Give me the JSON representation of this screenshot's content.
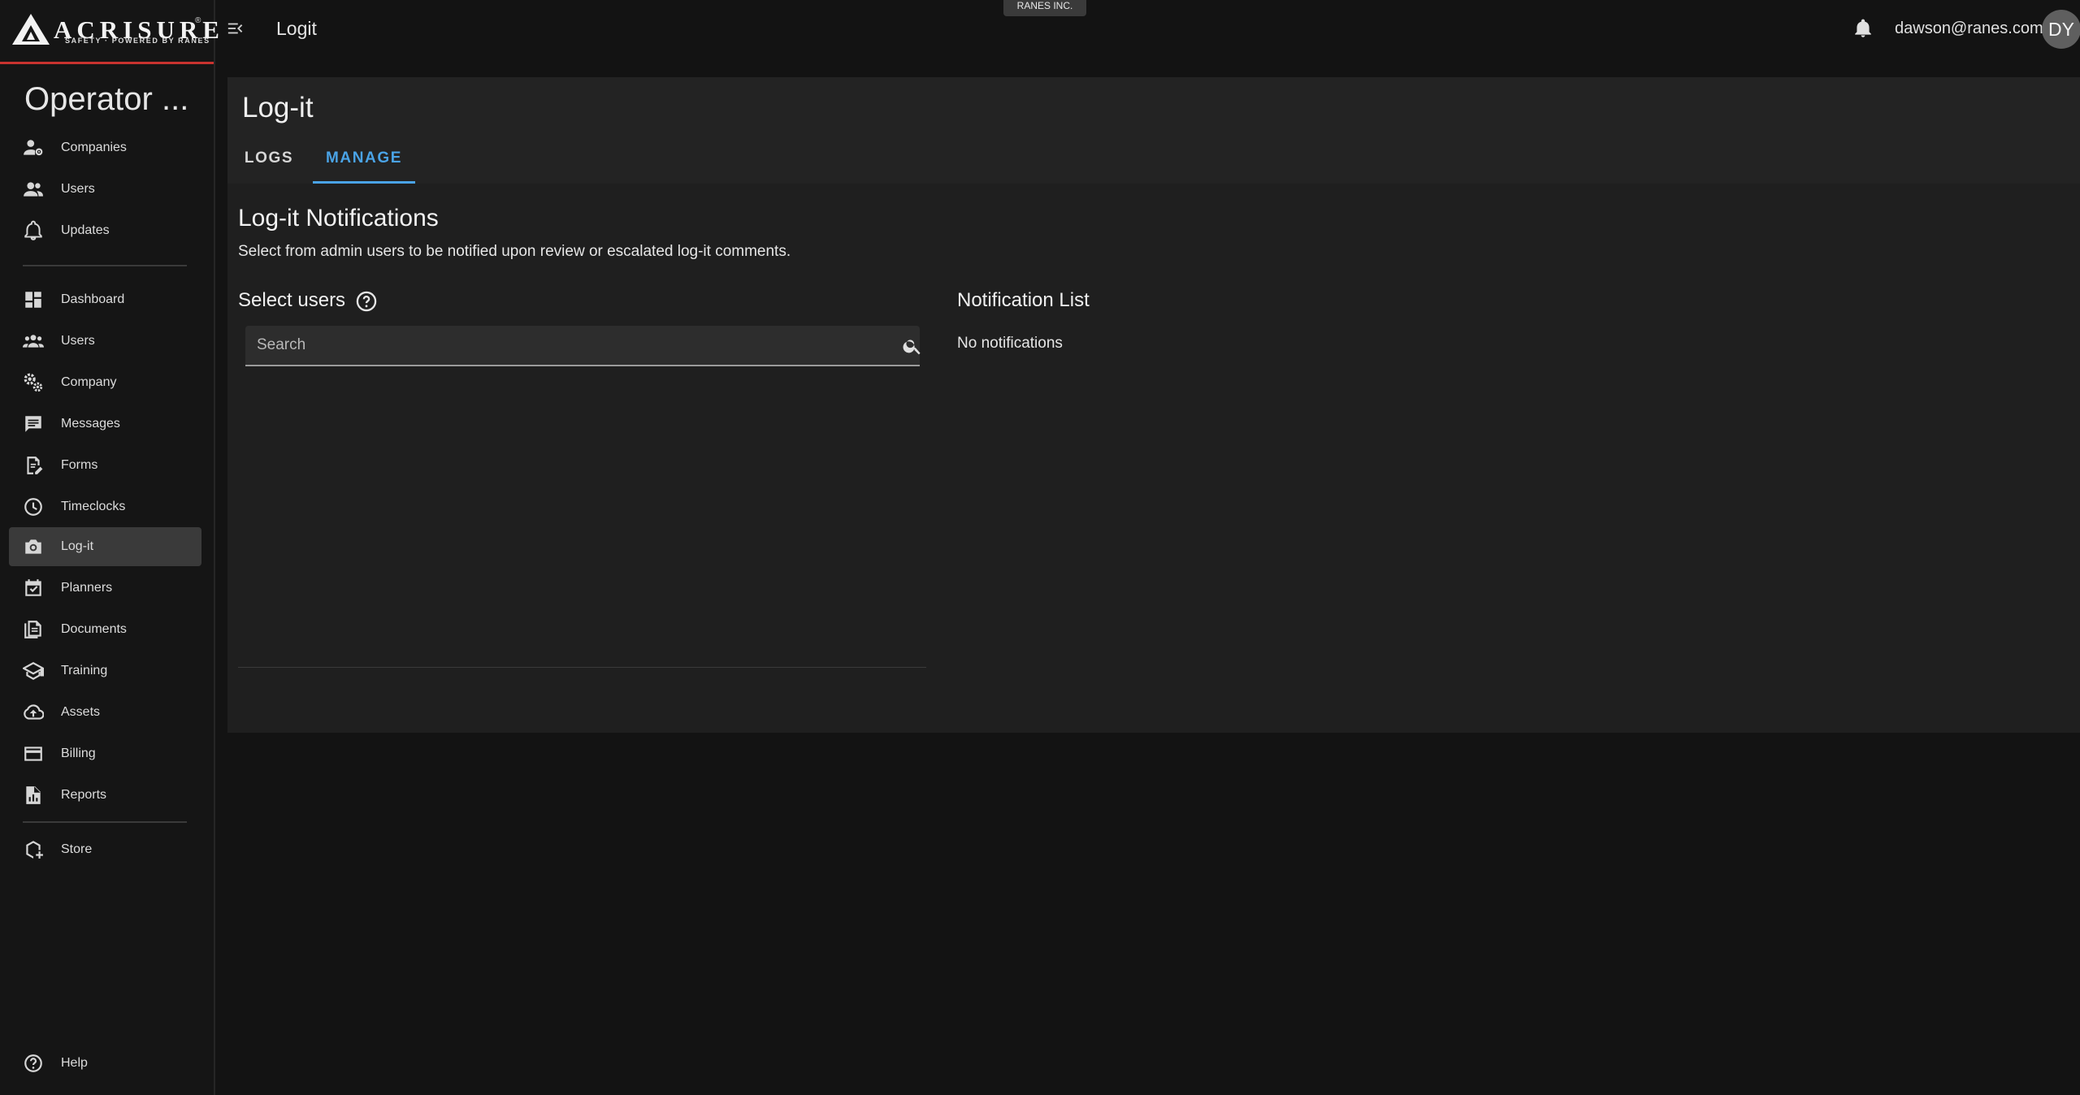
{
  "brand": {
    "name": "ACRISURE",
    "tagline": "SAFETY · POWERED BY RANES",
    "reg": "®"
  },
  "sidebar": {
    "title": "Operator ...",
    "top_items": [
      {
        "label": "Companies",
        "icon": "business-user-icon"
      },
      {
        "label": "Users",
        "icon": "users-icon"
      },
      {
        "label": "Updates",
        "icon": "bell-icon"
      }
    ],
    "items": [
      {
        "label": "Dashboard",
        "icon": "dashboard-icon"
      },
      {
        "label": "Users",
        "icon": "group-icon"
      },
      {
        "label": "Company",
        "icon": "gears-icon"
      },
      {
        "label": "Messages",
        "icon": "chat-icon"
      },
      {
        "label": "Forms",
        "icon": "form-edit-icon"
      },
      {
        "label": "Timeclocks",
        "icon": "clock-icon"
      },
      {
        "label": "Log-it",
        "icon": "camera-icon",
        "active": true
      },
      {
        "label": "Planners",
        "icon": "calendar-check-icon"
      },
      {
        "label": "Documents",
        "icon": "documents-icon"
      },
      {
        "label": "Training",
        "icon": "graduation-cap-icon"
      },
      {
        "label": "Assets",
        "icon": "cloud-upload-icon"
      },
      {
        "label": "Billing",
        "icon": "credit-card-icon"
      },
      {
        "label": "Reports",
        "icon": "report-icon"
      }
    ],
    "store": {
      "label": "Store",
      "icon": "store-icon"
    },
    "help": {
      "label": "Help",
      "icon": "help-icon"
    }
  },
  "topbar": {
    "title": "Logit",
    "org_badge": "RANES INC.",
    "user_email": "dawson@ranes.com",
    "avatar_initials": "DY"
  },
  "page": {
    "title": "Log-it",
    "tabs": [
      {
        "label": "LOGS",
        "active": false
      },
      {
        "label": "MANAGE",
        "active": true
      }
    ]
  },
  "manage": {
    "section_title": "Log-it Notifications",
    "description": "Select from admin users to be notified upon review or escalated log-it comments.",
    "select_label": "Select users",
    "search": {
      "placeholder": "Search",
      "value": ""
    },
    "notification_list_title": "Notification List",
    "notification_empty": "No notifications"
  },
  "colors": {
    "accent": "#4aa3e6",
    "brand_line": "#c8332f",
    "active_nav": "#3a3a3a"
  }
}
